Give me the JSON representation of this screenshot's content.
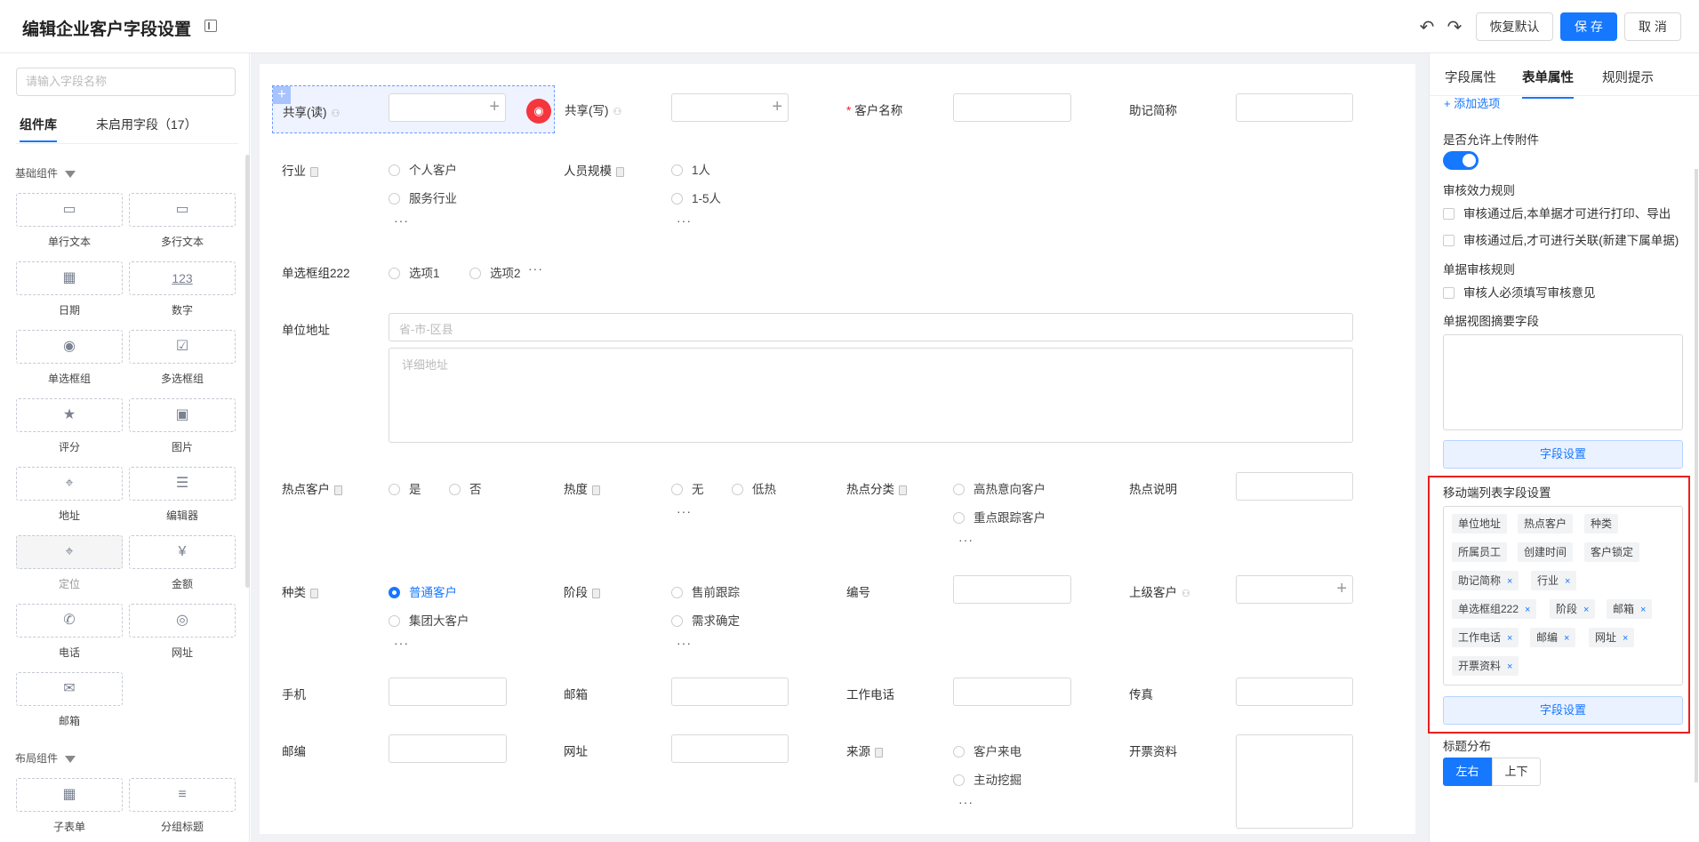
{
  "header": {
    "title": "编辑企业客户字段设置",
    "restore": "恢复默认",
    "save": "保 存",
    "cancel": "取 消"
  },
  "left": {
    "search_placeholder": "请输入字段名称",
    "tab_library": "组件库",
    "tab_unused": "未启用字段（17）",
    "section_basic": "基础组件",
    "section_layout": "布局组件",
    "components": {
      "single_text": "单行文本",
      "multi_text": "多行文本",
      "date": "日期",
      "number": "数字",
      "radio": "单选框组",
      "checkbox": "多选框组",
      "rating": "评分",
      "image": "图片",
      "address": "地址",
      "editor": "编辑器",
      "location": "定位",
      "amount": "金额",
      "phone": "电话",
      "url": "网址",
      "email": "邮箱",
      "subtable": "子表单",
      "group_title": "分组标题"
    },
    "number_glyph": "123"
  },
  "form": {
    "share_read": "共享(读)",
    "share_write": "共享(写)",
    "customer_name": "客户名称",
    "mnemonic": "助记简称",
    "industry": "行业",
    "industry_opts": [
      "个人客户",
      "服务行业"
    ],
    "staff_size": "人员规模",
    "staff_opts": [
      "1人",
      "1-5人"
    ],
    "radio_group": "单选框组222",
    "radio_group_opts": [
      "选项1",
      "选项2"
    ],
    "address": "单位地址",
    "address_ph": "省-市-区县",
    "address_detail_ph": "详细地址",
    "hot_customer": "热点客户",
    "hot_opts": [
      "是",
      "否"
    ],
    "heat": "热度",
    "heat_opts": [
      "无",
      "低热"
    ],
    "hot_category": "热点分类",
    "hot_cat_opts": [
      "高热意向客户",
      "重点跟踪客户"
    ],
    "hot_note": "热点说明",
    "kind": "种类",
    "kind_opts": [
      "普通客户",
      "集团大客户"
    ],
    "stage": "阶段",
    "stage_opts": [
      "售前跟踪",
      "需求确定"
    ],
    "code": "编号",
    "parent": "上级客户",
    "mobile": "手机",
    "email": "邮箱",
    "work_phone": "工作电话",
    "fax": "传真",
    "zip": "邮编",
    "url": "网址",
    "source": "来源",
    "source_opts": [
      "客户来电",
      "主动挖掘"
    ],
    "invoice": "开票资料",
    "ellipsis": "···",
    "required_mark": "*"
  },
  "right": {
    "tabs": [
      "字段属性",
      "表单属性",
      "规则提示"
    ],
    "add_option": "+ 添加选项",
    "allow_attach": "是否允许上传附件",
    "audit_rule": "审核效力规则",
    "audit_opt1": "审核通过后,本单据才可进行打印、导出",
    "audit_opt2": "审核通过后,才可进行关联(新建下属单据)",
    "doc_audit_rule": "单据审核规则",
    "doc_audit_opt": "审核人必须填写审核意见",
    "summary_fields": "单据视图摘要字段",
    "field_settings": "字段设置",
    "mobile_list": "移动端列表字段设置",
    "tags": {
      "t1": "单位地址",
      "t2": "热点客户",
      "t3": "种类",
      "t4": "所属员工",
      "t5": "创建时间",
      "t6": "客户锁定",
      "t7": "助记简称",
      "t8": "行业",
      "t9": "单选框组222",
      "t10": "阶段",
      "t11": "邮箱",
      "t12": "工作电话",
      "t13": "邮编",
      "t14": "网址",
      "t15": "开票资料"
    },
    "remove_x": "×",
    "title_layout": "标题分布",
    "layout_lr": "左右",
    "layout_tb": "上下"
  },
  "colors": {
    "accent": "#1677ff",
    "danger": "#f5363d",
    "highlight": "#e8201f"
  }
}
